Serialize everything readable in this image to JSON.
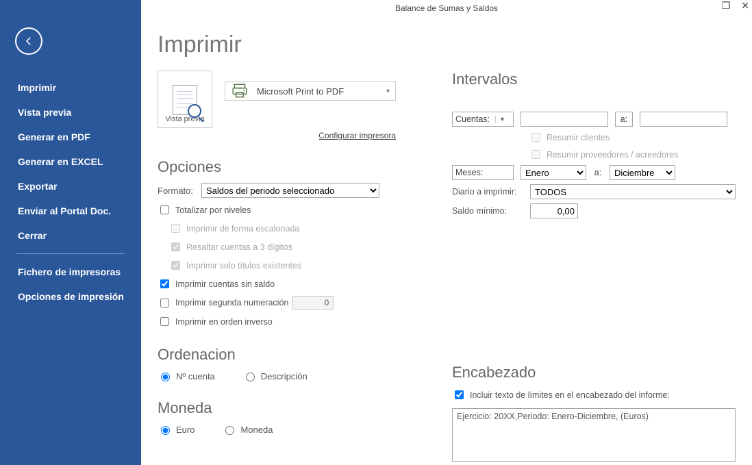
{
  "window": {
    "title": "Balance de Sumas y Saldos"
  },
  "sidebar": {
    "items": [
      "Imprimir",
      "Vista previa",
      "Generar en PDF",
      "Generar en EXCEL",
      "Exportar",
      "Enviar al Portal Doc.",
      "Cerrar"
    ],
    "bottom_items": [
      "Fichero de impresoras",
      "Opciones de impresión"
    ]
  },
  "page": {
    "title": "Imprimir"
  },
  "left": {
    "preview_label": "Vista previa",
    "printer_name": "Microsoft Print to PDF",
    "configure_printer": "Configurar impresora",
    "options_heading": "Opciones",
    "format_label": "Formato:",
    "format_value": "Saldos del periodo seleccionado",
    "chk_total_levels": "Totalizar por niveles",
    "chk_escalonada": "Imprimir de forma escalonada",
    "chk_resaltar3": "Resaltar cuentas a 3 dígitos",
    "chk_solo_titulos": "Imprimir solo títulos existentes",
    "chk_sin_saldo": "Imprimir cuentas sin saldo",
    "chk_segunda_num": "Imprimir segunda numeración",
    "segunda_num_value": "0",
    "chk_orden_inverso": "Imprimir en orden inverso",
    "ordenacion_heading": "Ordenacion",
    "radio_cuenta": "Nº cuenta",
    "radio_descripcion": "Descripción",
    "moneda_heading": "Moneda",
    "radio_euro": "Euro",
    "radio_moneda": "Moneda"
  },
  "right": {
    "intervalos_heading": "Intervalos",
    "cuentas_label": "Cuentas:",
    "a_label": "a:",
    "resumir_clientes": "Resumir clientes",
    "resumir_proveedores": "Resumir proveedores / acreedores",
    "meses_label": "Meses:",
    "meses_from": "Enero",
    "meses_to": "Diciembre",
    "diario_label": "Diario a imprimir:",
    "diario_value": "TODOS",
    "saldo_min_label": "Saldo mínimo:",
    "saldo_min_value": "0,00",
    "encabezado_heading": "Encabezado",
    "incluir_texto": "Incluir texto de límites en el encabezado del informe:",
    "encabezado_text": "Ejercicio: 20XX,Periodo: Enero-Diciembre, (Euros)"
  }
}
